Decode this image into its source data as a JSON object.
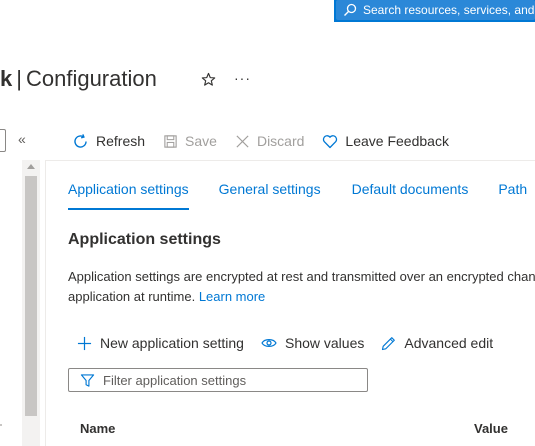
{
  "topbar": {
    "search_placeholder": "Search resources, services, and docs (G+/)",
    "accent_color": "#0078d4"
  },
  "header": {
    "title_prefix": "k",
    "separator": "|",
    "title": "Configuration",
    "favorite_icon": "star-icon",
    "more_label": "···"
  },
  "leftmenu": {
    "collapse_label": "«"
  },
  "commandbar": {
    "refresh": "Refresh",
    "save": "Save",
    "discard": "Discard",
    "feedback": "Leave Feedback"
  },
  "tabs": [
    {
      "label": "Application settings",
      "active": true
    },
    {
      "label": "General settings",
      "active": false
    },
    {
      "label": "Default documents",
      "active": false
    },
    {
      "label": "Path",
      "active": false
    }
  ],
  "section": {
    "title": "Application settings",
    "desc_line1": "Application settings are encrypted at rest and transmitted over an encrypted channel.",
    "desc_line2": "application at runtime.",
    "learn_more": "Learn more"
  },
  "actions": {
    "new_setting": "New application setting",
    "show_values": "Show values",
    "advanced_edit": "Advanced edit"
  },
  "filter": {
    "placeholder": "Filter application settings"
  },
  "table": {
    "columns": [
      "Name",
      "Value"
    ]
  }
}
